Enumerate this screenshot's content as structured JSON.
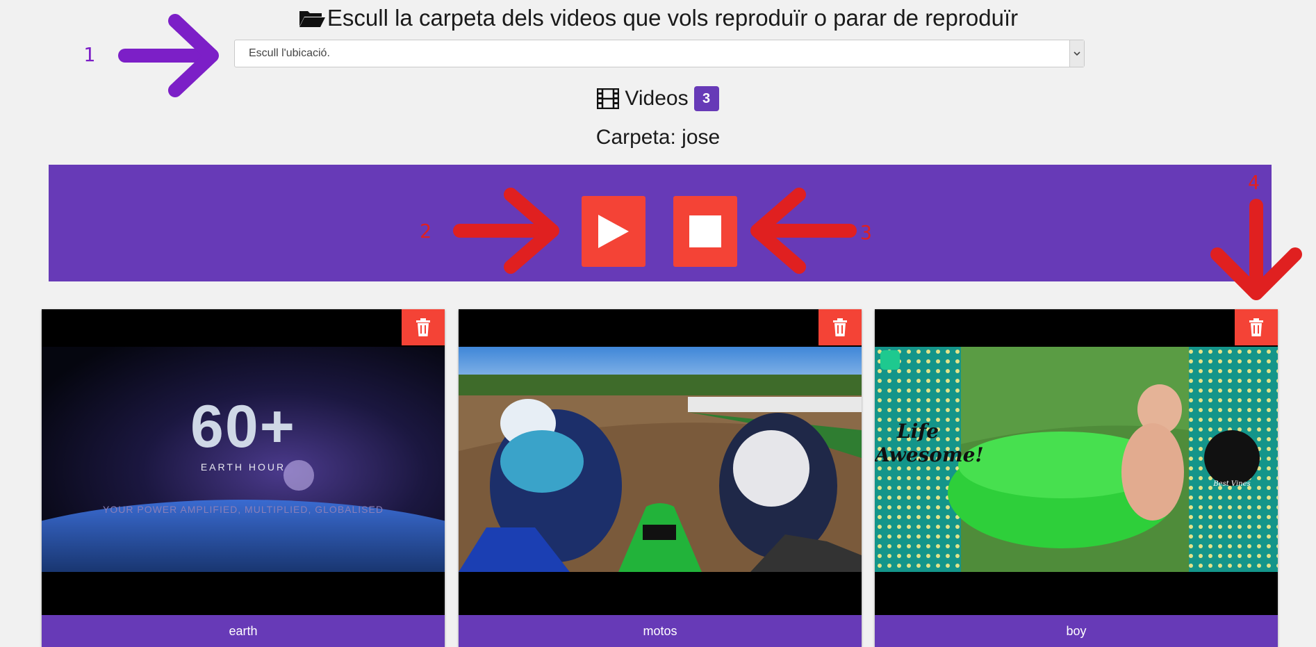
{
  "header": {
    "title": "Escull la carpeta dels videos que vols reproduïr o parar de reproduïr",
    "folder_icon": "open-folder-icon"
  },
  "location_select": {
    "selected": "Escull l'ubicació."
  },
  "videos": {
    "label": "Videos",
    "count": "3",
    "icon": "film-icon"
  },
  "folder": {
    "text": "Carpeta: jose"
  },
  "controls": {
    "play_icon": "play-icon",
    "stop_icon": "stop-icon"
  },
  "annotations": {
    "n1": "1",
    "n2": "2",
    "n3": "3",
    "n4": "4"
  },
  "cards": [
    {
      "caption": "earth",
      "thumb_text": "60+",
      "thumb_sub": "EARTH HOUR",
      "thumb_tag": "YOUR POWER AMPLIFIED, MULTIPLIED, GLOBALISED"
    },
    {
      "caption": "motos"
    },
    {
      "caption": "boy",
      "thumb_left": "Life Awesome!",
      "thumb_right": "Best Vines"
    }
  ],
  "colors": {
    "primary": "#673ab7",
    "danger": "#f44336",
    "annotation_purple": "#7c1fc7",
    "annotation_red": "#e02020"
  }
}
